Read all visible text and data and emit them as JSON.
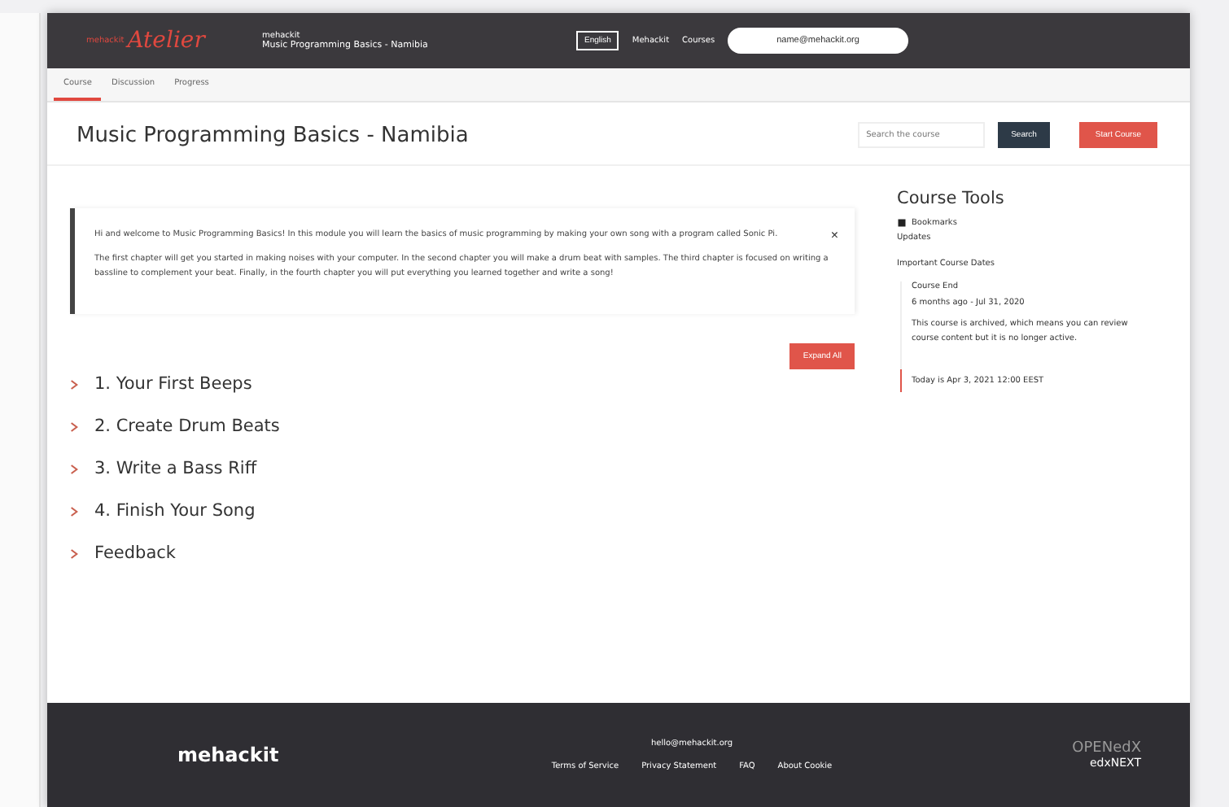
{
  "header": {
    "logo_small": "mehackit",
    "logo_script": "Atelier",
    "org": "mehackit",
    "course_title": "Music Programming Basics - Namibia",
    "language": "English",
    "links": [
      "Mehackit",
      "Courses"
    ],
    "user": "name@mehackit.org"
  },
  "tabs": [
    {
      "label": "Course",
      "selected": true
    },
    {
      "label": "Discussion",
      "selected": false
    },
    {
      "label": "Progress",
      "selected": false
    }
  ],
  "title": "Music Programming Basics - Namibia",
  "search": {
    "placeholder": "Search the course",
    "button": "Search"
  },
  "start_button": "Start Course",
  "welcome": {
    "paragraphs": [
      "Hi and welcome to Music Programming Basics! In this module you will learn the basics of music programming by making your own song with a program called Sonic Pi.",
      "The first chapter will get you started in making noises with your computer. In the second chapter you will make a drum beat with samples. The third chapter is focused on writing a bassline to complement your beat. Finally, in the fourth chapter you will put everything you learned together and write a song!"
    ],
    "dismiss": "×"
  },
  "expand_all": "Expand All",
  "sections": [
    {
      "title": "1. Your First Beeps",
      "expanded": false
    },
    {
      "title": "2. Create Drum Beats",
      "expanded": false
    },
    {
      "title": "3. Write a Bass Riff",
      "expanded": false
    },
    {
      "title": "4. Finish Your Song",
      "expanded": false
    },
    {
      "title": "Feedback",
      "expanded": false
    }
  ],
  "tools": {
    "heading": "Course Tools",
    "items": [
      "Bookmarks",
      "Updates"
    ],
    "dates_heading": "Important Course Dates",
    "date_title": "Course End",
    "date_value": "6 months ago - Jul 31, 2020",
    "note": "This course is archived, which means you can review course content but it is no longer active.",
    "today": "Today is Apr 3, 2021 12:00 EEST"
  },
  "footer": {
    "logo": "mehackit",
    "email": "hello@mehackit.org",
    "links": [
      "Terms of Service",
      "Privacy Statement",
      "FAQ",
      "About Cookie"
    ],
    "badge_top": "OPENedX",
    "badge_bottom": "edxNEXT"
  }
}
